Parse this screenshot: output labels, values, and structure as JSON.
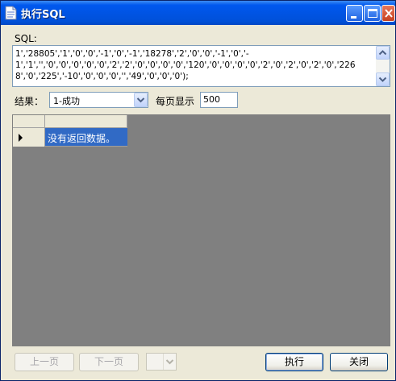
{
  "window": {
    "title": "执行SQL"
  },
  "sql": {
    "label": "SQL:",
    "text": "1','28805','1','0','0','-1','0','-1','18278','2','0','0','-1','0','-1','1','','0','0','0','0','0','2','2','0','0','0','0','120','0','0','0','0','2','0','2','0','2','0','2268','0','225','-10','0','0','0','','49','0','0','0');"
  },
  "options": {
    "result_label": "结果：",
    "result_value": "1-成功",
    "pagesize_label": "每页显示",
    "pagesize_value": "500"
  },
  "grid": {
    "message": "没有返回数据。"
  },
  "buttons": {
    "prev": "上一页",
    "next": "下一页",
    "execute": "执行",
    "close": "关闭"
  },
  "colors": {
    "titlebar": "#0054E3",
    "grid_bg": "#808080",
    "selection": "#316AC5"
  },
  "icons": [
    "document-icon",
    "minimize-icon",
    "maximize-icon",
    "close-icon",
    "scroll-up-icon",
    "scroll-down-icon",
    "dropdown-arrow-icon",
    "row-pointer-icon"
  ]
}
